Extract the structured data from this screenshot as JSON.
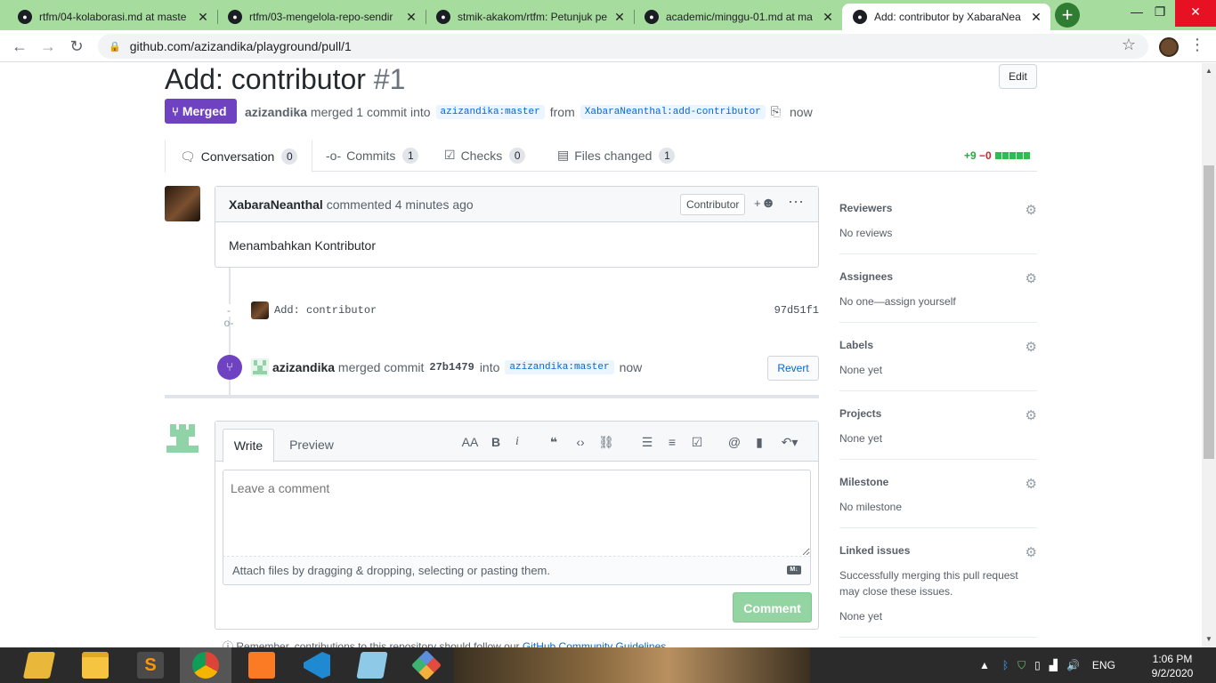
{
  "browser": {
    "tabs": [
      {
        "title": "rtfm/04-kolaborasi.md at maste",
        "active": false
      },
      {
        "title": "rtfm/03-mengelola-repo-sendir",
        "active": false
      },
      {
        "title": "stmik-akakom/rtfm: Petunjuk pe",
        "active": false
      },
      {
        "title": "academic/minggu-01.md at ma",
        "active": false
      },
      {
        "title": "Add: contributor by XabaraNea",
        "active": true
      }
    ],
    "url": "github.com/azizandika/playground/pull/1",
    "accent_color": "#a7dc9f"
  },
  "pr": {
    "title": "Add: contributor",
    "number": "#1",
    "edit_label": "Edit",
    "status": "Merged",
    "merger": "azizandika",
    "merged_text": "merged 1 commit into",
    "base_branch": "azizandika:master",
    "from_text": "from",
    "head_branch": "XabaraNeanthal:add-contributor",
    "time": "now",
    "status_color": "#6f42c1"
  },
  "tabs": [
    {
      "label": "Conversation",
      "count": "0"
    },
    {
      "label": "Commits",
      "count": "1"
    },
    {
      "label": "Checks",
      "count": "0"
    },
    {
      "label": "Files changed",
      "count": "1"
    }
  ],
  "diffstat": {
    "additions": "+9",
    "deletions": "−0"
  },
  "comment": {
    "author": "XabaraNeanthal",
    "action": "commented 4 minutes ago",
    "badge": "Contributor",
    "emoji_label": "+",
    "body": "Menambahkan Kontributor"
  },
  "commit": {
    "message": "Add: contributor",
    "sha": "97d51f1"
  },
  "merge_event": {
    "author": "azizandika",
    "text1": "merged commit",
    "sha": "27b1479",
    "text2": "into",
    "branch": "azizandika:master",
    "time": "now",
    "revert_label": "Revert"
  },
  "new_comment": {
    "write_tab": "Write",
    "preview_tab": "Preview",
    "placeholder": "Leave a comment",
    "attach_text": "Attach files by dragging & dropping, selecting or pasting them.",
    "button": "Comment",
    "guidelines_text": "Remember, contributions to this repository should follow our",
    "guidelines_link": "GitHub Community Guidelines"
  },
  "sidebar": [
    {
      "heading": "Reviewers",
      "value": "No reviews"
    },
    {
      "heading": "Assignees",
      "value": "No one—assign yourself"
    },
    {
      "heading": "Labels",
      "value": "None yet"
    },
    {
      "heading": "Projects",
      "value": "None yet"
    },
    {
      "heading": "Milestone",
      "value": "No milestone"
    },
    {
      "heading": "Linked issues",
      "value": "Successfully merging this pull request may close these issues.",
      "value2": "None yet"
    }
  ],
  "taskbar": {
    "language": "ENG",
    "time": "1:06 PM",
    "date": "9/2/2020"
  }
}
